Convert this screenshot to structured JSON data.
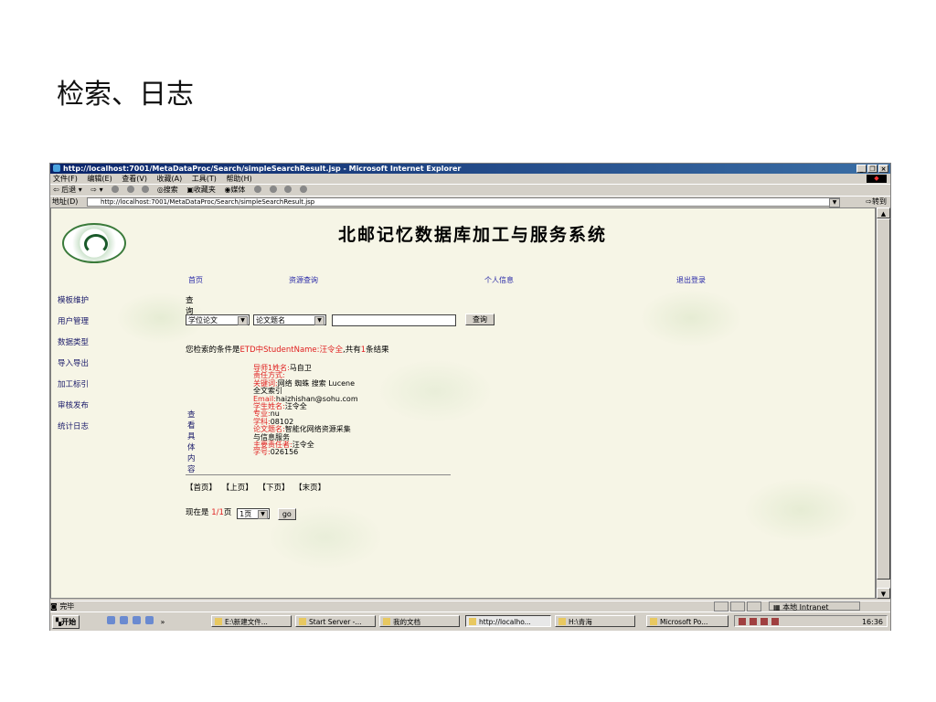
{
  "slide": {
    "title": "检索、日志"
  },
  "window": {
    "title": "http://localhost:7001/MetaDataProc/Search/simpleSearchResult.jsp - Microsoft Internet Explorer",
    "controls": [
      "_",
      "❐",
      "×"
    ]
  },
  "menubar": [
    "文件(F)",
    "编辑(E)",
    "查看(V)",
    "收藏(A)",
    "工具(T)",
    "帮助(H)"
  ],
  "toolbar": {
    "back": "⇦ 后退 ▾",
    "forward": "⇨ ▾",
    "search": "搜索",
    "favorites": "收藏夹",
    "media": "媒体"
  },
  "addressbar": {
    "label": "地址(D)",
    "url": "http://localhost:7001/MetaDataProc/Search/simpleSearchResult.jsp",
    "go": "转到"
  },
  "page": {
    "system_title": "北邮记忆数据库加工与服务系统",
    "nav": [
      "首页",
      "资源查询",
      "个人信息",
      "退出登录"
    ],
    "sidebar": [
      "模板维护",
      "用户管理",
      "数据类型",
      "导入导出",
      "加工标引",
      "审核发布",
      "统计日志"
    ],
    "section_title": "查询",
    "search": {
      "type_select": "学位论文",
      "field_select": "论文题名",
      "keyword": "",
      "button": "查询"
    },
    "condition": {
      "prefix": "您检索的条件是",
      "expr": "ETD中StudentName:汪令全",
      "mid": ",共有",
      "count": "1",
      "suffix": "条结果"
    },
    "detail_link": "查看具体内容",
    "record": [
      {
        "k": "导师1姓名:",
        "v": "马自卫"
      },
      {
        "k": "责任方式:",
        "v": ""
      },
      {
        "k": "关键词:",
        "v": "网络 蜘蛛 搜索 Lucene 全文索引"
      },
      {
        "k": "Email:",
        "v": "haizhishan@sohu.com"
      },
      {
        "k": "学生姓名:",
        "v": "汪令全"
      },
      {
        "k": "专业:",
        "v": "nu"
      },
      {
        "k": "学科:",
        "v": "08102"
      },
      {
        "k": "论文题名:",
        "v": "智能化网络资源采集与信息服务"
      },
      {
        "k": "主要责任者:",
        "v": "汪令全"
      },
      {
        "k": "学号:",
        "v": "026156"
      }
    ],
    "pager": [
      "【首页】",
      "【上页】",
      "【下页】",
      "【末页】"
    ],
    "page_info": {
      "prefix": "现在是 ",
      "current": "1/1",
      "suffix": "页",
      "select": "1页",
      "go": "go"
    }
  },
  "statusbar": {
    "left": "完毕",
    "zone": "本地 Intranet"
  },
  "taskbar": {
    "start": "开始",
    "tasks": [
      "E:\\新建文件...",
      "Start Server -...",
      "我的文档",
      "http://localho...",
      "H:\\青海",
      "Microsoft Po..."
    ],
    "clock": "16:36"
  }
}
